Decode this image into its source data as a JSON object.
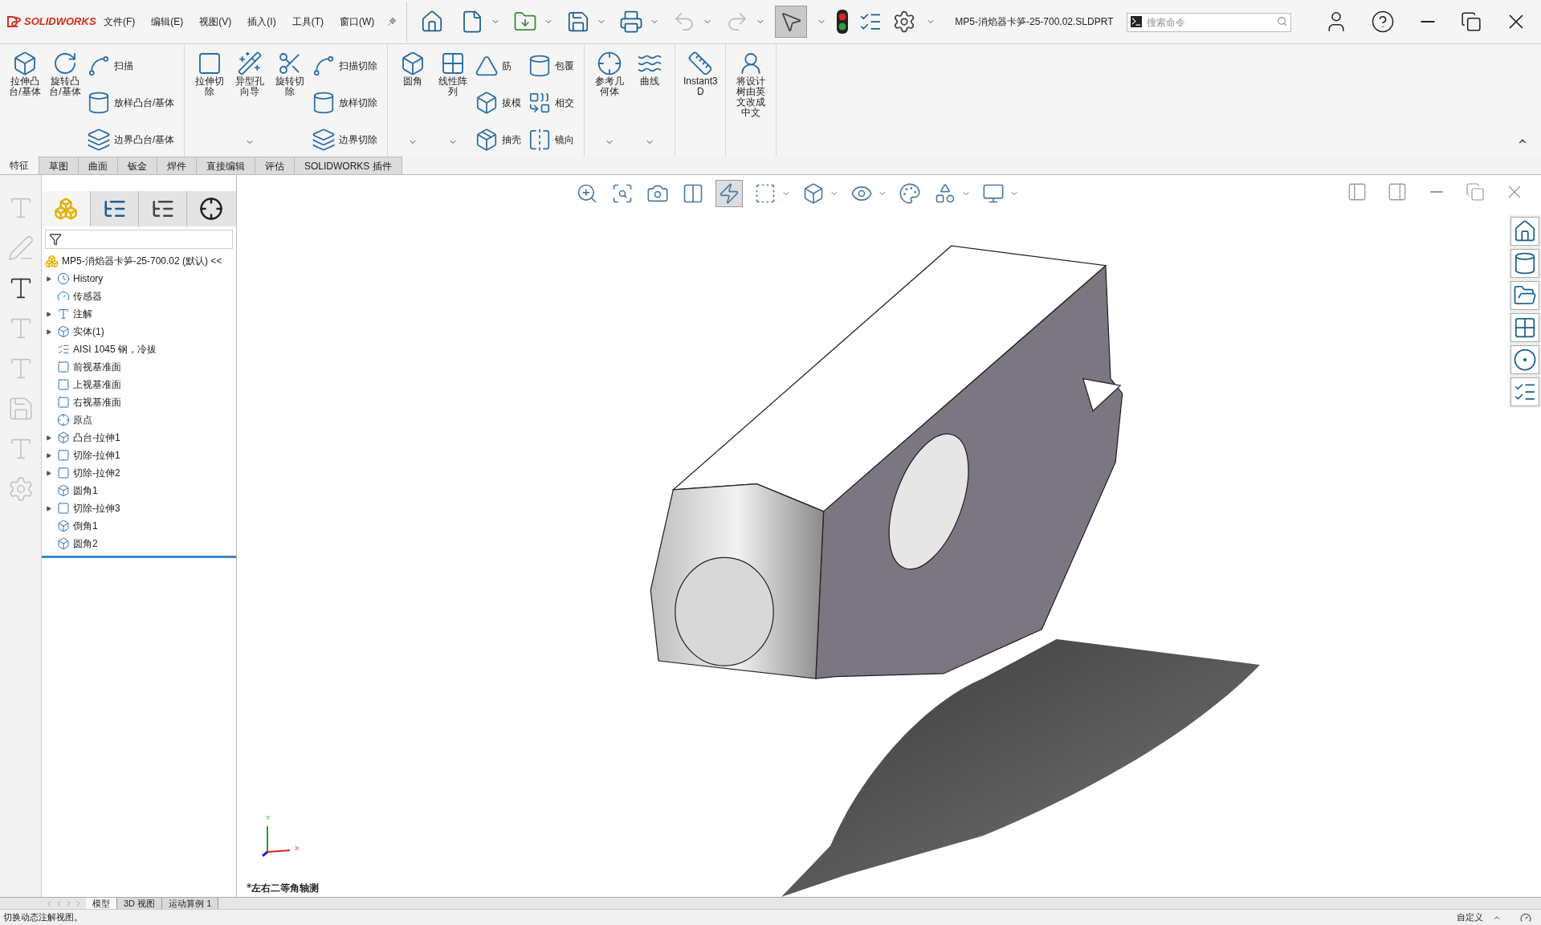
{
  "app": {
    "logo": "SOLIDWORKS",
    "title": "MP5-消焰器卡笋-25-700.02.SLDPRT"
  },
  "menu": [
    "文件(F)",
    "编辑(E)",
    "视图(V)",
    "插入(I)",
    "工具(T)",
    "窗口(W)"
  ],
  "search": {
    "placeholder": "搜索命令"
  },
  "ribbon": {
    "groups": [
      {
        "columns": [
          {
            "kind": "large",
            "label": "拉伸凸台/基体",
            "dropdown": false
          },
          {
            "kind": "large",
            "label": "旋转凸台/基体",
            "dropdown": false
          },
          {
            "kind": "stack",
            "items": [
              "扫描",
              "放样凸台/基体",
              "边界凸台/基体"
            ]
          }
        ]
      },
      {
        "columns": [
          {
            "kind": "large",
            "label": "拉伸切除",
            "dropdown": false
          },
          {
            "kind": "large",
            "label": "异型孔向导",
            "dropdown": true
          },
          {
            "kind": "large",
            "label": "旋转切除",
            "dropdown": false
          },
          {
            "kind": "stack",
            "items": [
              "扫描切除",
              "放样切除",
              "边界切除"
            ]
          }
        ]
      },
      {
        "columns": [
          {
            "kind": "large",
            "label": "圆角",
            "dropdown": true
          },
          {
            "kind": "large",
            "label": "线性阵列",
            "dropdown": true
          },
          {
            "kind": "stack",
            "items": [
              "筋",
              "拔模",
              "抽壳"
            ]
          },
          {
            "kind": "stack",
            "items": [
              "包覆",
              "相交",
              "镜向"
            ]
          }
        ]
      },
      {
        "columns": [
          {
            "kind": "large",
            "label": "参考几何体",
            "dropdown": true
          },
          {
            "kind": "large",
            "label": "曲线",
            "dropdown": true
          }
        ]
      },
      {
        "columns": [
          {
            "kind": "large",
            "label": "Instant3D",
            "dropdown": false
          }
        ]
      },
      {
        "columns": [
          {
            "kind": "large",
            "label": "将设计树由英文改成中文",
            "dropdown": false
          }
        ]
      }
    ]
  },
  "tabs": [
    {
      "label": "特征",
      "selected": true
    },
    {
      "label": "草图",
      "selected": false
    },
    {
      "label": "曲面",
      "selected": false
    },
    {
      "label": "钣金",
      "selected": false
    },
    {
      "label": "焊件",
      "selected": false
    },
    {
      "label": "直接编辑",
      "selected": false
    },
    {
      "label": "评估",
      "selected": false
    },
    {
      "label": "SOLIDWORKS 插件",
      "selected": false
    }
  ],
  "tree": {
    "root": "MP5-消焰器卡笋-25-700.02 (默认) <<",
    "items": [
      {
        "label": "History",
        "collapsed": true
      },
      {
        "label": "传感器",
        "collapsed": false
      },
      {
        "label": "注解",
        "collapsed": true
      },
      {
        "label": "实体(1)",
        "collapsed": true
      },
      {
        "label": "AISI 1045 钢，冷拔",
        "collapsed": false
      },
      {
        "label": "前视基准面",
        "collapsed": false
      },
      {
        "label": "上视基准面",
        "collapsed": false
      },
      {
        "label": "右视基准面",
        "collapsed": false
      },
      {
        "label": "原点",
        "collapsed": false
      },
      {
        "label": "凸台-拉伸1",
        "collapsed": true
      },
      {
        "label": "切除-拉伸1",
        "collapsed": true
      },
      {
        "label": "切除-拉伸2",
        "collapsed": true
      },
      {
        "label": "圆角1",
        "collapsed": false
      },
      {
        "label": "切除-拉伸3",
        "collapsed": true
      },
      {
        "label": "倒角1",
        "collapsed": false
      },
      {
        "label": "圆角2",
        "collapsed": false
      }
    ]
  },
  "viewport": {
    "view_name": "*左右二等角轴测",
    "axis_labels": [
      "Y",
      "X"
    ]
  },
  "bottom_tabs": [
    {
      "label": "模型",
      "selected": true
    },
    {
      "label": "3D 视图",
      "selected": false
    },
    {
      "label": "运动算例 1",
      "selected": false
    }
  ],
  "status_bar": {
    "message": "切换动态注解视图。",
    "unit_system": "自定义"
  }
}
